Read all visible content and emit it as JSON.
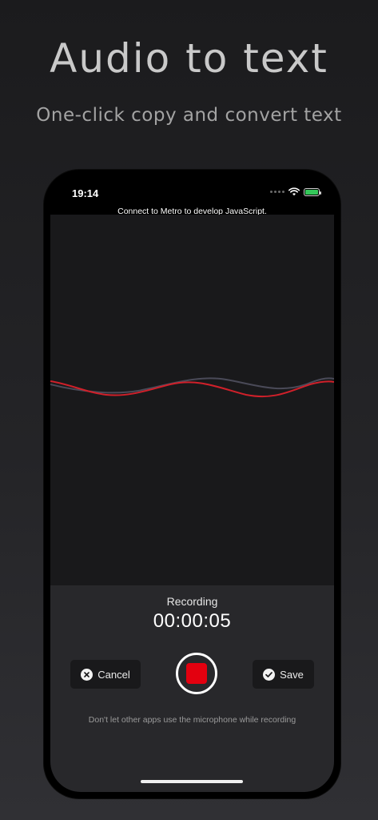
{
  "promo": {
    "title": "Audio to text",
    "subtitle": "One-click copy and convert text"
  },
  "status_bar": {
    "time": "19:14",
    "icons": [
      "signal-dots-icon",
      "wifi-icon",
      "battery-charging-icon"
    ]
  },
  "dev_banner": "Connect to Metro to develop JavaScript.",
  "recorder": {
    "state_label": "Recording",
    "elapsed": "00:00:05",
    "cancel_label": "Cancel",
    "save_label": "Save",
    "hint": "Don't let other apps use the microphone while recording"
  },
  "colors": {
    "wave_primary": "#d0202a",
    "wave_secondary": "#4a4a58",
    "record_stop": "#e3000f",
    "battery_fill": "#34c759"
  }
}
